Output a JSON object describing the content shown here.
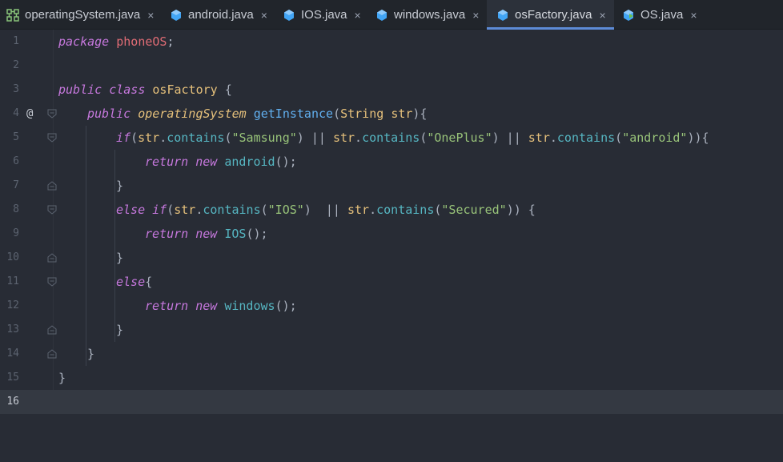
{
  "tabs": [
    {
      "label": "operatingSystem.java",
      "icon": "interface-icon",
      "active": false
    },
    {
      "label": "android.java",
      "icon": "class-file-icon",
      "active": false
    },
    {
      "label": "IOS.java",
      "icon": "class-file-icon",
      "active": false
    },
    {
      "label": "windows.java",
      "icon": "class-file-icon",
      "active": false
    },
    {
      "label": "osFactory.java",
      "icon": "class-file-icon",
      "active": true
    },
    {
      "label": "OS.java",
      "icon": "main-class-icon",
      "active": false
    }
  ],
  "close_glyph": "×",
  "override_marker": "@",
  "line_numbers": [
    "1",
    "2",
    "3",
    "4",
    "5",
    "6",
    "7",
    "8",
    "9",
    "10",
    "11",
    "12",
    "13",
    "14",
    "15",
    "16"
  ],
  "current_line": 16,
  "code": {
    "l1": {
      "kw": "package",
      "name": "phoneOS",
      "end": ";"
    },
    "l3": {
      "kw1": "public",
      "kw2": "class",
      "name": "osFactory",
      "end": " {"
    },
    "l4": {
      "kw": "public",
      "type": "operatingSystem",
      "fn": "getInstance",
      "p1": "(",
      "ptype": "String",
      "pname": "str",
      "end": "){"
    },
    "l5": {
      "kw": "if",
      "open": "(",
      "v1": "str",
      "m1": "contains",
      "s1": "\"Samsung\"",
      "v2": "str",
      "m2": "contains",
      "s2": "\"OnePlus\"",
      "v3": "str",
      "m3": "contains",
      "s3": "\"android\"",
      "or": " || ",
      "end": ")){"
    },
    "l6": {
      "kw1": "return",
      "kw2": "new",
      "name": "android",
      "end": "();"
    },
    "l7": {
      "text": "}"
    },
    "l8": {
      "kw1": "else",
      "kw2": "if",
      "open": "(",
      "v1": "str",
      "m1": "contains",
      "s1": "\"IOS\"",
      "or": "  || ",
      "v2": "str",
      "m2": "contains",
      "s2": "\"Secured\"",
      "end": ")) {"
    },
    "l9": {
      "kw1": "return",
      "kw2": "new",
      "name": "IOS",
      "end": "();"
    },
    "l10": {
      "text": "}"
    },
    "l11": {
      "kw": "else",
      "end": "{"
    },
    "l12": {
      "kw1": "return",
      "kw2": "new",
      "name": "windows",
      "end": "();"
    },
    "l13": {
      "text": "}"
    },
    "l14": {
      "text": "}"
    },
    "l15": {
      "text": "}"
    }
  }
}
